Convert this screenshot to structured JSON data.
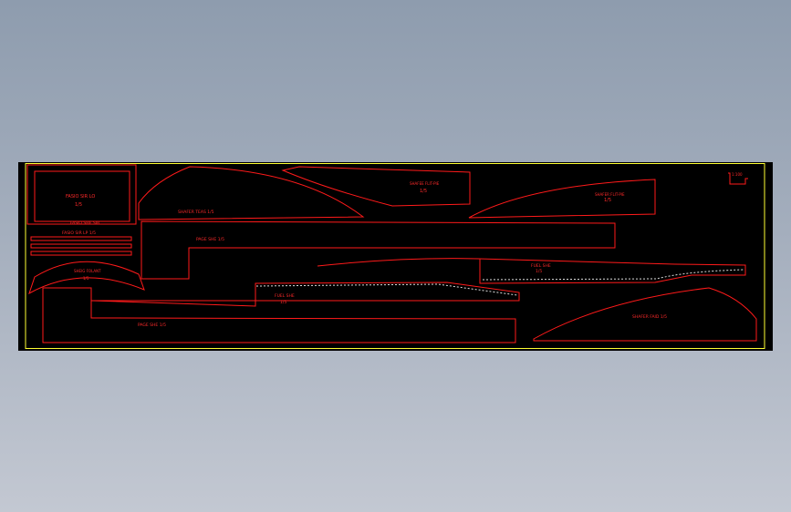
{
  "colors": {
    "background_top": "#8e9cae",
    "background_bottom": "#c3c8d2",
    "canvas": "#000000",
    "layout_border": "#ffff33",
    "geometry": "#ff1a1a",
    "text": "#ff2a2a",
    "dashed": "#dddddd"
  },
  "labels": {
    "top_left_box": "FASIO SIR LO",
    "top_left_box_scale": "1/5",
    "below_box": "FASIO SHE SIR",
    "strip": "FASIO SIR LP 1/5",
    "arc_piece": "SHEIG FOLANT",
    "arc_piece_scale": "1/5",
    "top_shape_1": "SHAFER TEAS 1/5",
    "top_shape_2": "SHAFEE FLIT-PIE",
    "top_shape_2_scale": "1/5",
    "right_top": "SHAFER FLIT-PIE",
    "right_top_scale": "1/5",
    "long_bar": "PAGE SHE 1/5",
    "mid_right": "FUEL SHE",
    "mid_right_scale": "1/5",
    "center": "FUEL SHE",
    "center_scale": "1/5",
    "bottom_long": "PAGE SHE 1/5",
    "bottom_right": "SHAFER FAID 1/5",
    "corner_tag": "1:100"
  }
}
